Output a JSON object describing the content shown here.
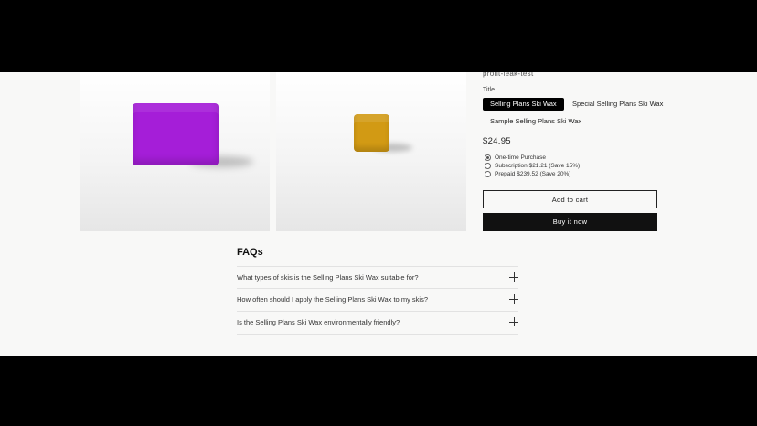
{
  "product": {
    "vendor": "profit-leak-test",
    "option_label": "Title",
    "variants": [
      "Selling Plans Ski Wax",
      "Special Selling Plans Ski Wax",
      "Sample Selling Plans Ski Wax"
    ],
    "selected_variant": "Selling Plans Ski Wax",
    "price": "$24.95",
    "purchase_options": [
      {
        "label": "One-time Purchase",
        "selected": true
      },
      {
        "label": "Subscription $21.21 (Save 15%)",
        "selected": false
      },
      {
        "label": "Prepaid $239.52 (Save 20%)",
        "selected": false
      }
    ],
    "add_to_cart_label": "Add to cart",
    "buy_now_label": "Buy it now",
    "gallery": [
      {
        "image": "purple-ski-wax",
        "color": "#a51ed8"
      },
      {
        "image": "yellow-ski-wax",
        "color": "#d29a14"
      }
    ]
  },
  "faqs": {
    "title": "FAQs",
    "items": [
      {
        "question": "What types of skis is the Selling Plans Ski Wax suitable for?",
        "icon": "plus-icon"
      },
      {
        "question": "How often should I apply the Selling Plans Ski Wax to my skis?",
        "icon": "plus-icon"
      },
      {
        "question": "Is the Selling Plans Ski Wax environmentally friendly?",
        "icon": "plus-icon"
      }
    ]
  }
}
